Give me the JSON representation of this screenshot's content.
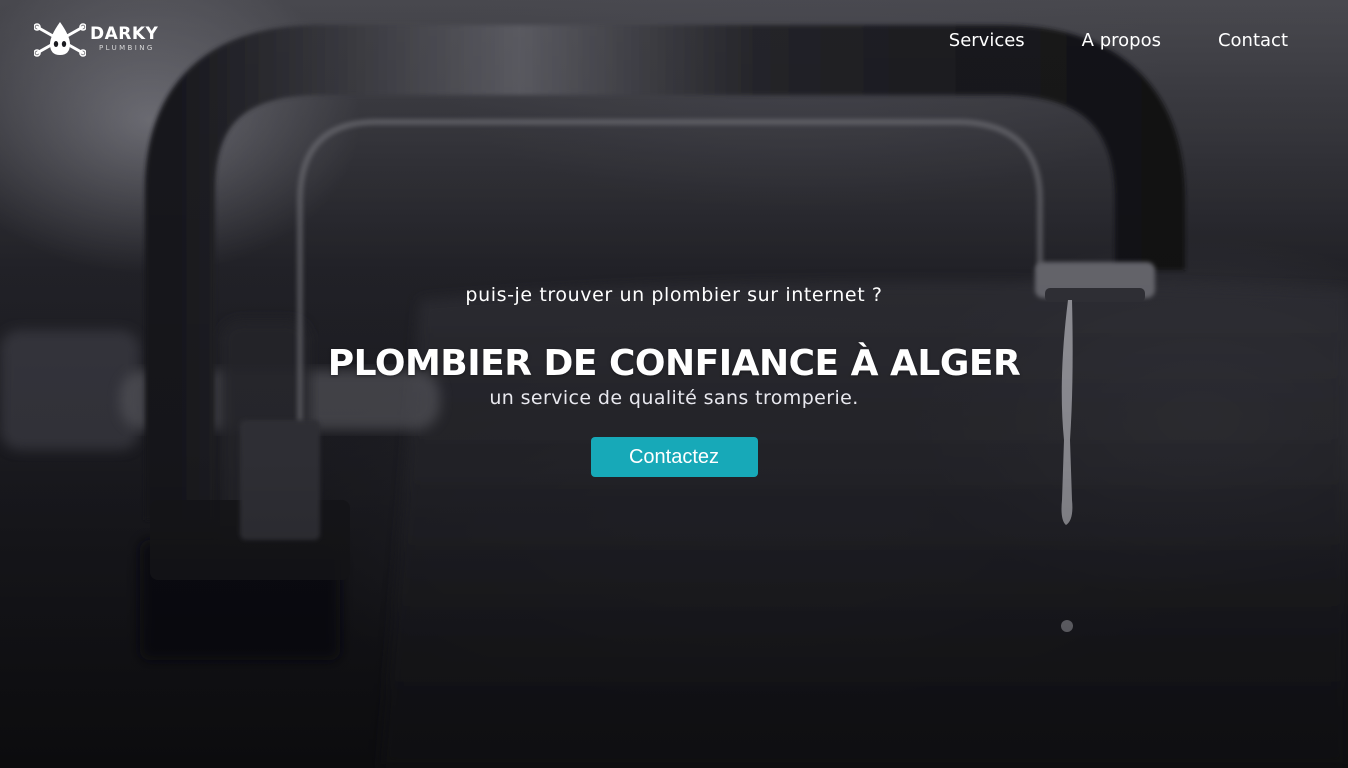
{
  "brand": {
    "name": "DARKY",
    "tagline": "PLUMBING"
  },
  "nav": {
    "items": [
      "Services",
      "A propos",
      "Contact"
    ]
  },
  "hero": {
    "kicker": "puis-je trouver un plombier sur internet ?",
    "headline": "PLOMBIER DE CONFIANCE À ALGER",
    "subheadline": "un service de qualité sans tromperie.",
    "cta_label": "Contactez"
  },
  "colors": {
    "accent": "#17a9b8",
    "text": "#ffffff"
  },
  "icons": {
    "logo": "water-drop-with-wrenches-icon"
  }
}
